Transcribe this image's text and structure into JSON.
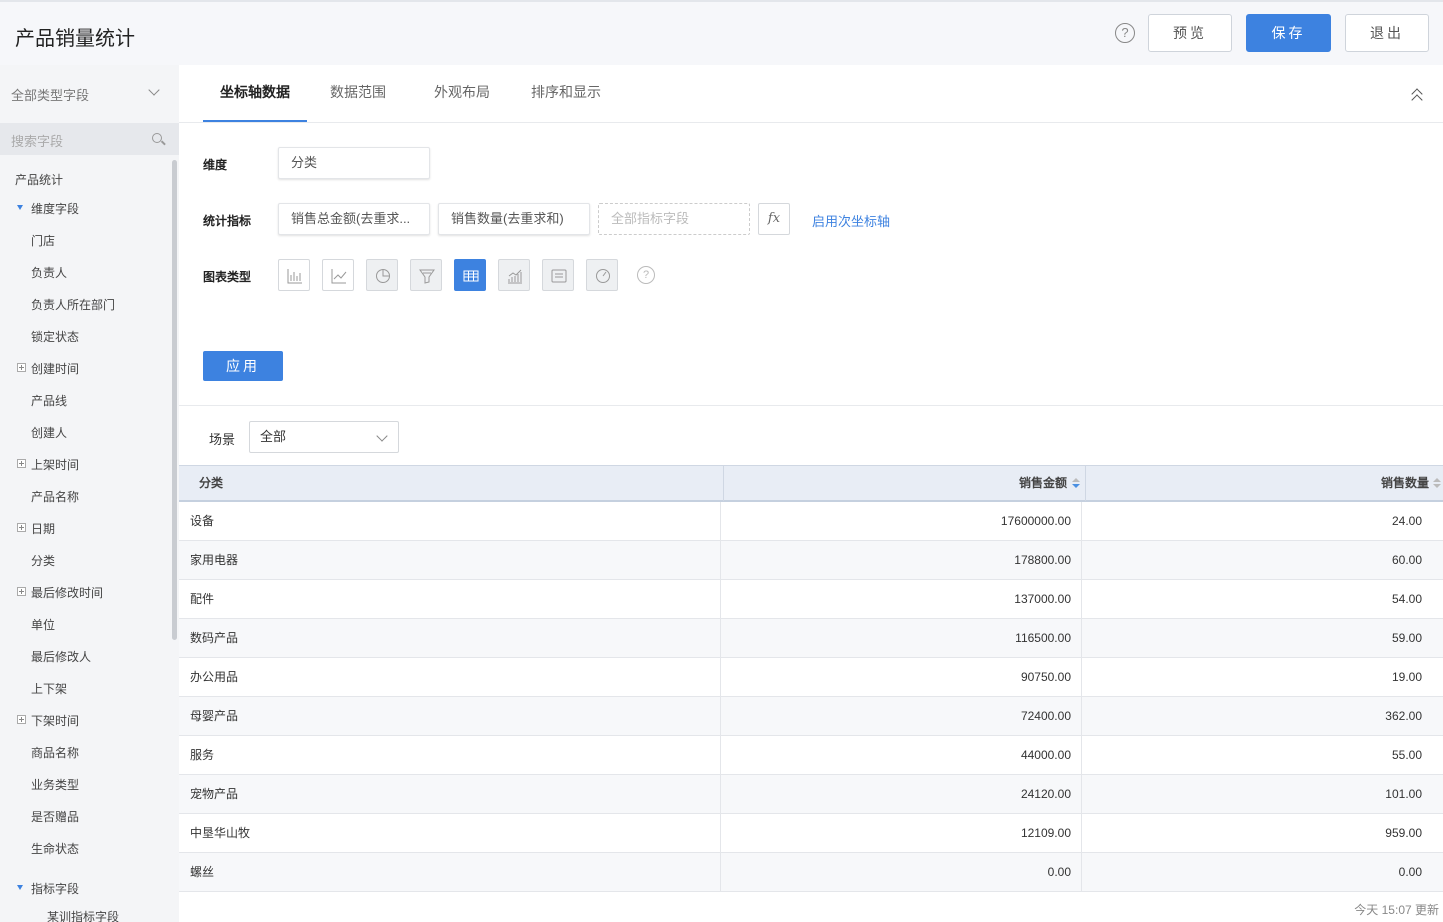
{
  "header": {
    "title": "产品销量统计",
    "help_icon": "question-icon",
    "preview_label": "预览",
    "save_label": "保存",
    "exit_label": "退出"
  },
  "sidebar": {
    "type_select": "全部类型字段",
    "search_placeholder": "搜索字段",
    "group_title": "产品统计",
    "dimension_header": "维度字段",
    "items": [
      {
        "label": "门店",
        "expandable": false
      },
      {
        "label": "负责人",
        "expandable": false
      },
      {
        "label": "负责人所在部门",
        "expandable": false
      },
      {
        "label": "锁定状态",
        "expandable": false
      },
      {
        "label": "创建时间",
        "expandable": true
      },
      {
        "label": "产品线",
        "expandable": false
      },
      {
        "label": "创建人",
        "expandable": false
      },
      {
        "label": "上架时间",
        "expandable": true
      },
      {
        "label": "产品名称",
        "expandable": false
      },
      {
        "label": "日期",
        "expandable": true
      },
      {
        "label": "分类",
        "expandable": false
      },
      {
        "label": "最后修改时间",
        "expandable": true
      },
      {
        "label": "单位",
        "expandable": false
      },
      {
        "label": "最后修改人",
        "expandable": false
      },
      {
        "label": "上下架",
        "expandable": false
      },
      {
        "label": "下架时间",
        "expandable": true
      },
      {
        "label": "商品名称",
        "expandable": false
      },
      {
        "label": "业务类型",
        "expandable": false
      },
      {
        "label": "是否赠品",
        "expandable": false
      },
      {
        "label": "生命状态",
        "expandable": false
      }
    ],
    "metric_header": "指标字段",
    "metric_sub": "某训指标字段"
  },
  "tabs": [
    {
      "label": "坐标轴数据",
      "active": true
    },
    {
      "label": "数据范围",
      "active": false
    },
    {
      "label": "外观布局",
      "active": false
    },
    {
      "label": "排序和显示",
      "active": false
    }
  ],
  "config": {
    "dimension_label": "维度",
    "dimension_value": "分类",
    "metric_label": "统计指标",
    "metrics": [
      "销售总金额(去重求...",
      "销售数量(去重求和)"
    ],
    "metric_placeholder": "全部指标字段",
    "fx_label": "fx",
    "secondary_axis_link": "启用次坐标轴",
    "chart_type_label": "图表类型",
    "chart_types": [
      "bar-chart-icon",
      "line-chart-icon",
      "pie-chart-icon",
      "funnel-chart-icon",
      "table-chart-icon",
      "area-chart-icon",
      "card-chart-icon",
      "gauge-chart-icon"
    ],
    "active_chart_type": "table-chart-icon",
    "apply_label": "应用"
  },
  "scene": {
    "label": "场景",
    "value": "全部"
  },
  "table": {
    "columns": [
      "分类",
      "销售金额",
      "销售数量"
    ],
    "rows": [
      [
        "设备",
        "17600000.00",
        "24.00"
      ],
      [
        "家用电器",
        "178800.00",
        "60.00"
      ],
      [
        "配件",
        "137000.00",
        "54.00"
      ],
      [
        "数码产品",
        "116500.00",
        "59.00"
      ],
      [
        "办公用品",
        "90750.00",
        "19.00"
      ],
      [
        "母婴产品",
        "72400.00",
        "362.00"
      ],
      [
        "服务",
        "44000.00",
        "55.00"
      ],
      [
        "宠物产品",
        "24120.00",
        "101.00"
      ],
      [
        "中垦华山牧",
        "12109.00",
        "959.00"
      ],
      [
        "螺丝",
        "0.00",
        "0.00"
      ]
    ]
  },
  "footer": {
    "updated": "今天 15:07 更新"
  },
  "colors": {
    "accent": "#3d82e0",
    "header_bg": "#e8edf5"
  }
}
